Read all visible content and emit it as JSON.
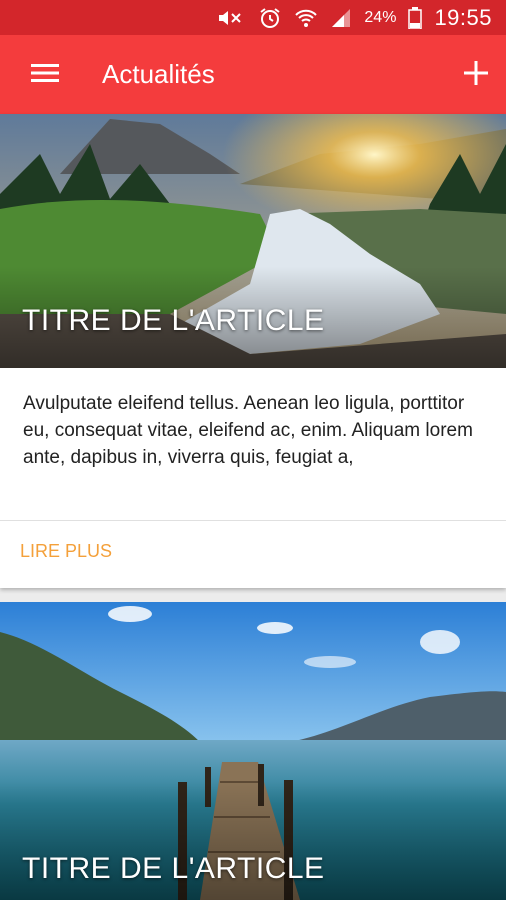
{
  "status_bar": {
    "battery": "24%",
    "time": "19:55",
    "icons": [
      "mute-icon",
      "alarm-icon",
      "wifi-icon",
      "signal-icon",
      "battery-icon"
    ]
  },
  "app_bar": {
    "title": "Actualités",
    "menu_icon": "hamburger-menu-icon",
    "add_icon": "plus-icon",
    "color": "#f43c3d",
    "status_color": "#d3262b"
  },
  "articles": [
    {
      "title": "TITRE DE L'ARTICLE",
      "excerpt": "Avulputate eleifend tellus. Aenean leo ligula, porttitor eu, consequat vitae, eleifend ac, enim. Aliquam lorem ante, dapibus in, viverra quis, feugiat a,",
      "action": "LIRE PLUS",
      "image": "waterfall-landscape"
    },
    {
      "title": "TITRE DE L'ARTICLE",
      "image": "lake-pier-landscape"
    }
  ],
  "accent": "#f4a03a"
}
